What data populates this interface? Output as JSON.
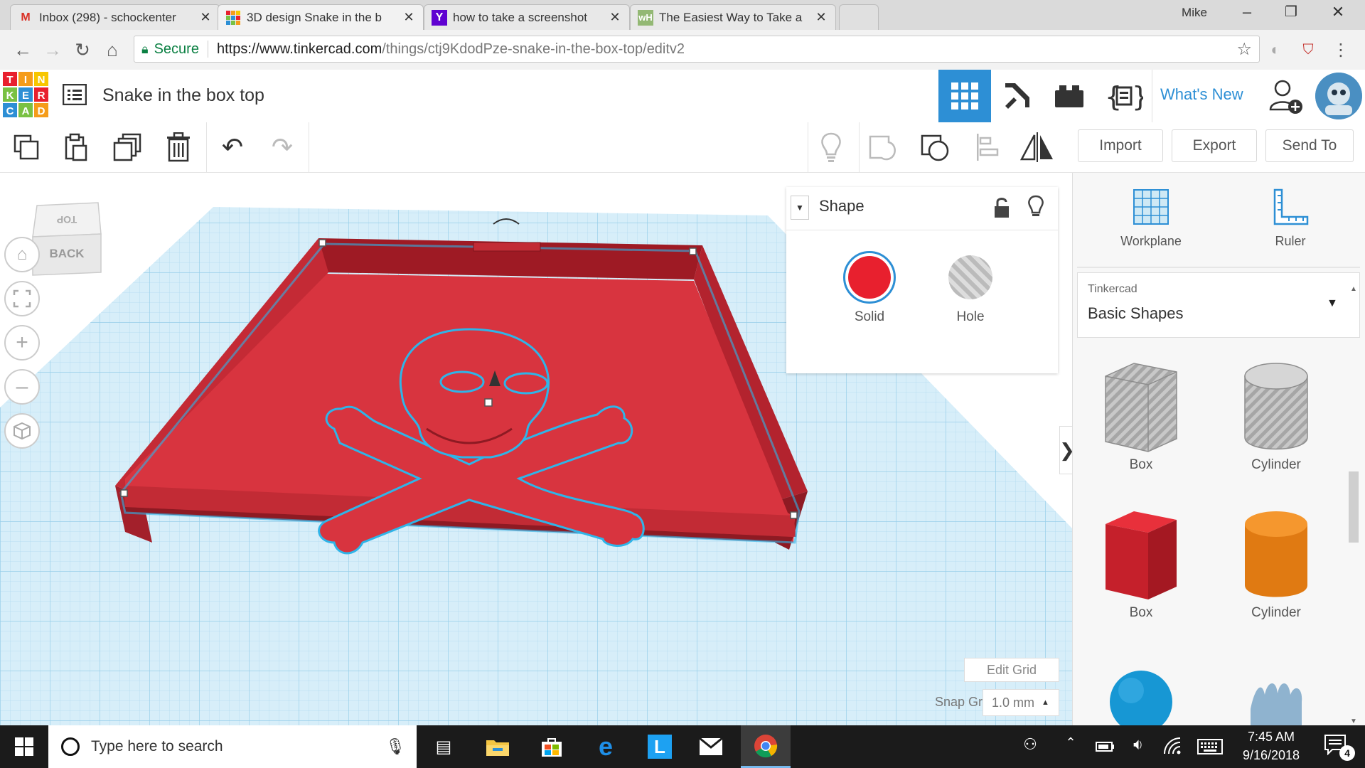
{
  "browser": {
    "user": "Mike",
    "tabs": [
      {
        "title": "Inbox (298) - schockenter",
        "icon": "gmail-icon",
        "active": false
      },
      {
        "title": "3D design Snake in the b",
        "icon": "tinkercad-icon",
        "active": true
      },
      {
        "title": "how to take a screenshot",
        "icon": "yahoo-icon",
        "active": false
      },
      {
        "title": "The Easiest Way to Take a",
        "icon": "wikihow-icon",
        "active": false
      }
    ],
    "secure_label": "Secure",
    "url_base": "https://www.tinkercad.com",
    "url_path": "/things/ctj9KdodPze-snake-in-the-box-top/editv2"
  },
  "app": {
    "logo_letters": [
      "T",
      "I",
      "N",
      "K",
      "E",
      "R",
      "C",
      "A",
      "D"
    ],
    "design_title": "Snake in the box top",
    "whats_new": "What's New"
  },
  "toolbar": {
    "import_label": "Import",
    "export_label": "Export",
    "send_to_label": "Send To"
  },
  "viewcube": {
    "top_label": "TOP",
    "front_label": "BACK"
  },
  "shape_panel": {
    "title": "Shape",
    "solid_label": "Solid",
    "hole_label": "Hole",
    "solid_color": "#e8202e"
  },
  "grid": {
    "edit_grid_label": "Edit Grid",
    "snap_grid_label": "Snap Grid",
    "snap_value": "1.0 mm"
  },
  "right_panel": {
    "workplane_label": "Workplane",
    "ruler_label": "Ruler",
    "library_category": "Tinkercad",
    "library_name": "Basic Shapes",
    "shapes": [
      {
        "label": "Box",
        "kind": "box-hole"
      },
      {
        "label": "Cylinder",
        "kind": "cylinder-hole"
      },
      {
        "label": "Box",
        "kind": "box-solid"
      },
      {
        "label": "Cylinder",
        "kind": "cylinder-solid"
      }
    ]
  },
  "taskbar": {
    "search_placeholder": "Type here to search",
    "time": "7:45 AM",
    "date": "9/16/2018",
    "notification_count": "4"
  },
  "colors": {
    "accent_blue": "#2d8fd5",
    "shape_red": "#d8343f",
    "grid_blue": "#cfe9f5"
  }
}
